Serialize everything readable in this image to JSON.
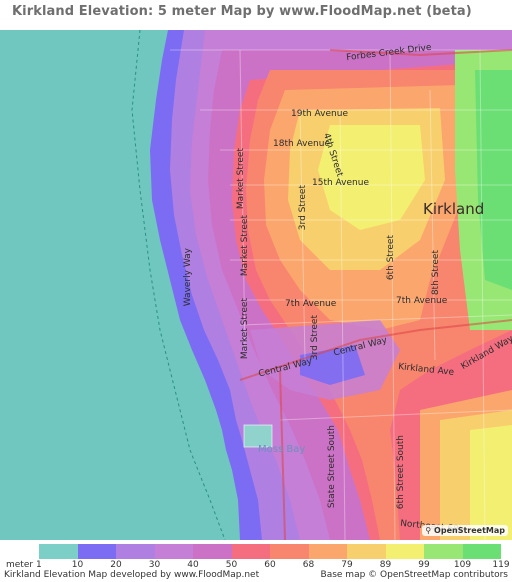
{
  "title": "Kirkland Elevation: 5 meter Map by www.FloodMap.net (beta)",
  "map": {
    "city_label": "Kirkland",
    "streets": {
      "forbes_creek": "Forbes Creek Drive",
      "nineteenth": "19th Avenue",
      "eighteenth": "18th Avenue",
      "fifteenth": "15th Avenue",
      "seventh_left": "7th Avenue",
      "seventh_right": "7th Avenue",
      "market1": "Market Street",
      "market2": "Market Street",
      "market3": "Market Street",
      "waverly": "Waverly Way",
      "third1": "3rd Street",
      "third2": "3rd Street",
      "fourth": "4th Street",
      "sixth": "6th Street",
      "eighth": "8th Street",
      "central1": "Central Way",
      "central2": "Central Way",
      "kirkland_ave": "Kirkland Ave",
      "kirkland_way": "Kirkland Way",
      "state": "State Street South",
      "sixth_south": "6th Street South",
      "northeast": "Northeast 68t",
      "moss_bay": "Moss Bay"
    },
    "logo_text": "OpenStreetMap"
  },
  "legend": {
    "unit": "meter",
    "first_tick": "1",
    "ticks": [
      "10",
      "20",
      "30",
      "40",
      "50",
      "60",
      "68",
      "79",
      "89",
      "99",
      "109",
      "119"
    ],
    "colors": [
      "#7ccfc6",
      "#7c6cf4",
      "#b07fe2",
      "#c57fd6",
      "#cc72c6",
      "#f56e80",
      "#f8856d",
      "#fba66d",
      "#f8cf6d",
      "#f3ef71",
      "#98e774",
      "#6bdf73"
    ]
  },
  "footer": {
    "left": "Kirkland Elevation Map developed by www.FloodMap.net",
    "right": "Base map © OpenStreetMap contributors"
  }
}
